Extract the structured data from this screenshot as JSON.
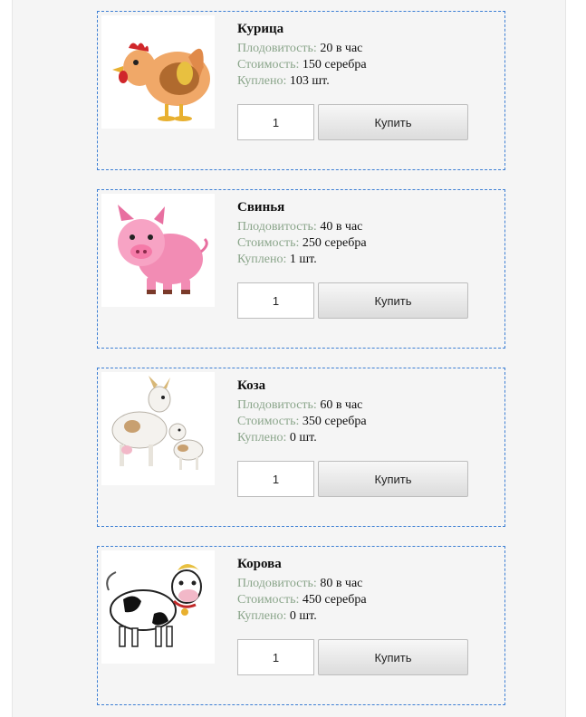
{
  "animals": [
    {
      "icon": "chicken-image",
      "name": "Курица",
      "fertility_label": "Плодовитость:",
      "fertility_value": "20 в час",
      "cost_label": "Стоимость:",
      "cost_value": "150 серебра",
      "bought_label": "Куплено:",
      "bought_value": "103 шт.",
      "quantity": "1",
      "buy_label": "Купить"
    },
    {
      "icon": "pig-image",
      "name": "Свинья",
      "fertility_label": "Плодовитость:",
      "fertility_value": "40 в час",
      "cost_label": "Стоимость:",
      "cost_value": "250 серебра",
      "bought_label": "Куплено:",
      "bought_value": "1 шт.",
      "quantity": "1",
      "buy_label": "Купить"
    },
    {
      "icon": "goat-image",
      "name": "Коза",
      "fertility_label": "Плодовитость:",
      "fertility_value": "60 в час",
      "cost_label": "Стоимость:",
      "cost_value": "350 серебра",
      "bought_label": "Куплено:",
      "bought_value": "0 шт.",
      "quantity": "1",
      "buy_label": "Купить"
    },
    {
      "icon": "cow-image",
      "name": "Корова",
      "fertility_label": "Плодовитость:",
      "fertility_value": "80 в час",
      "cost_label": "Стоимость:",
      "cost_value": "450 серебра",
      "bought_label": "Куплено:",
      "bought_value": "0 шт.",
      "quantity": "1",
      "buy_label": "Купить"
    }
  ],
  "colors": {
    "card_border": "#3d7fd4",
    "label_text": "#8aa58a",
    "page_background": "#f5f5f5"
  }
}
